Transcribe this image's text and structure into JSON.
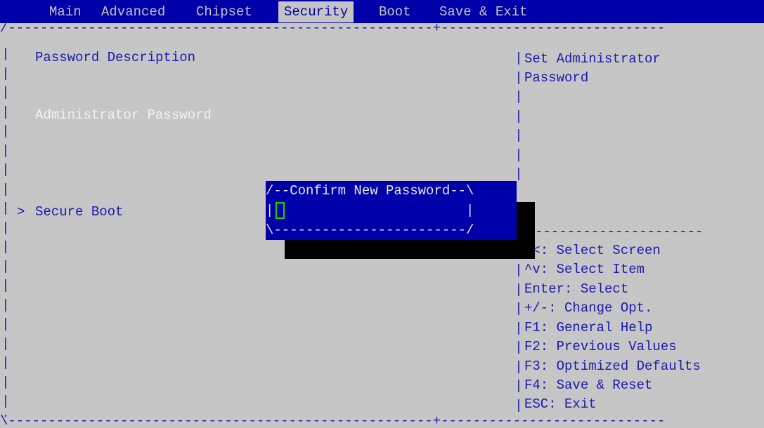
{
  "menu": {
    "items": [
      {
        "label": "Main",
        "active": false
      },
      {
        "label": "Advanced",
        "active": false
      },
      {
        "label": "Chipset",
        "active": false
      },
      {
        "label": "Security",
        "active": true
      },
      {
        "label": "Boot",
        "active": false
      },
      {
        "label": "Save & Exit",
        "active": false
      }
    ]
  },
  "left_panel": {
    "password_description": "Password Description",
    "administrator_password": "Administrator Password",
    "secure_boot_marker": ">",
    "secure_boot": "Secure Boot"
  },
  "right_panel": {
    "help_line1": "Set Administrator",
    "help_line2": "Password",
    "keys": [
      "><: Select Screen",
      "^v: Select Item",
      "Enter: Select",
      "+/-: Change Opt.",
      "F1: General Help",
      "F2: Previous Values",
      "F3: Optimized Defaults",
      "F4: Save & Reset",
      "ESC: Exit"
    ]
  },
  "dialog": {
    "title_line": "/--Confirm New Password--\\",
    "input_line": "|                        |",
    "bottom_line": "\\------------------------/",
    "password_value": ""
  },
  "colors": {
    "background": "#c6c6c6",
    "menubar": "#0000aa",
    "text_blue": "#1a1ab0",
    "dialog_bg": "#0000aa",
    "cursor": "#16d616"
  }
}
